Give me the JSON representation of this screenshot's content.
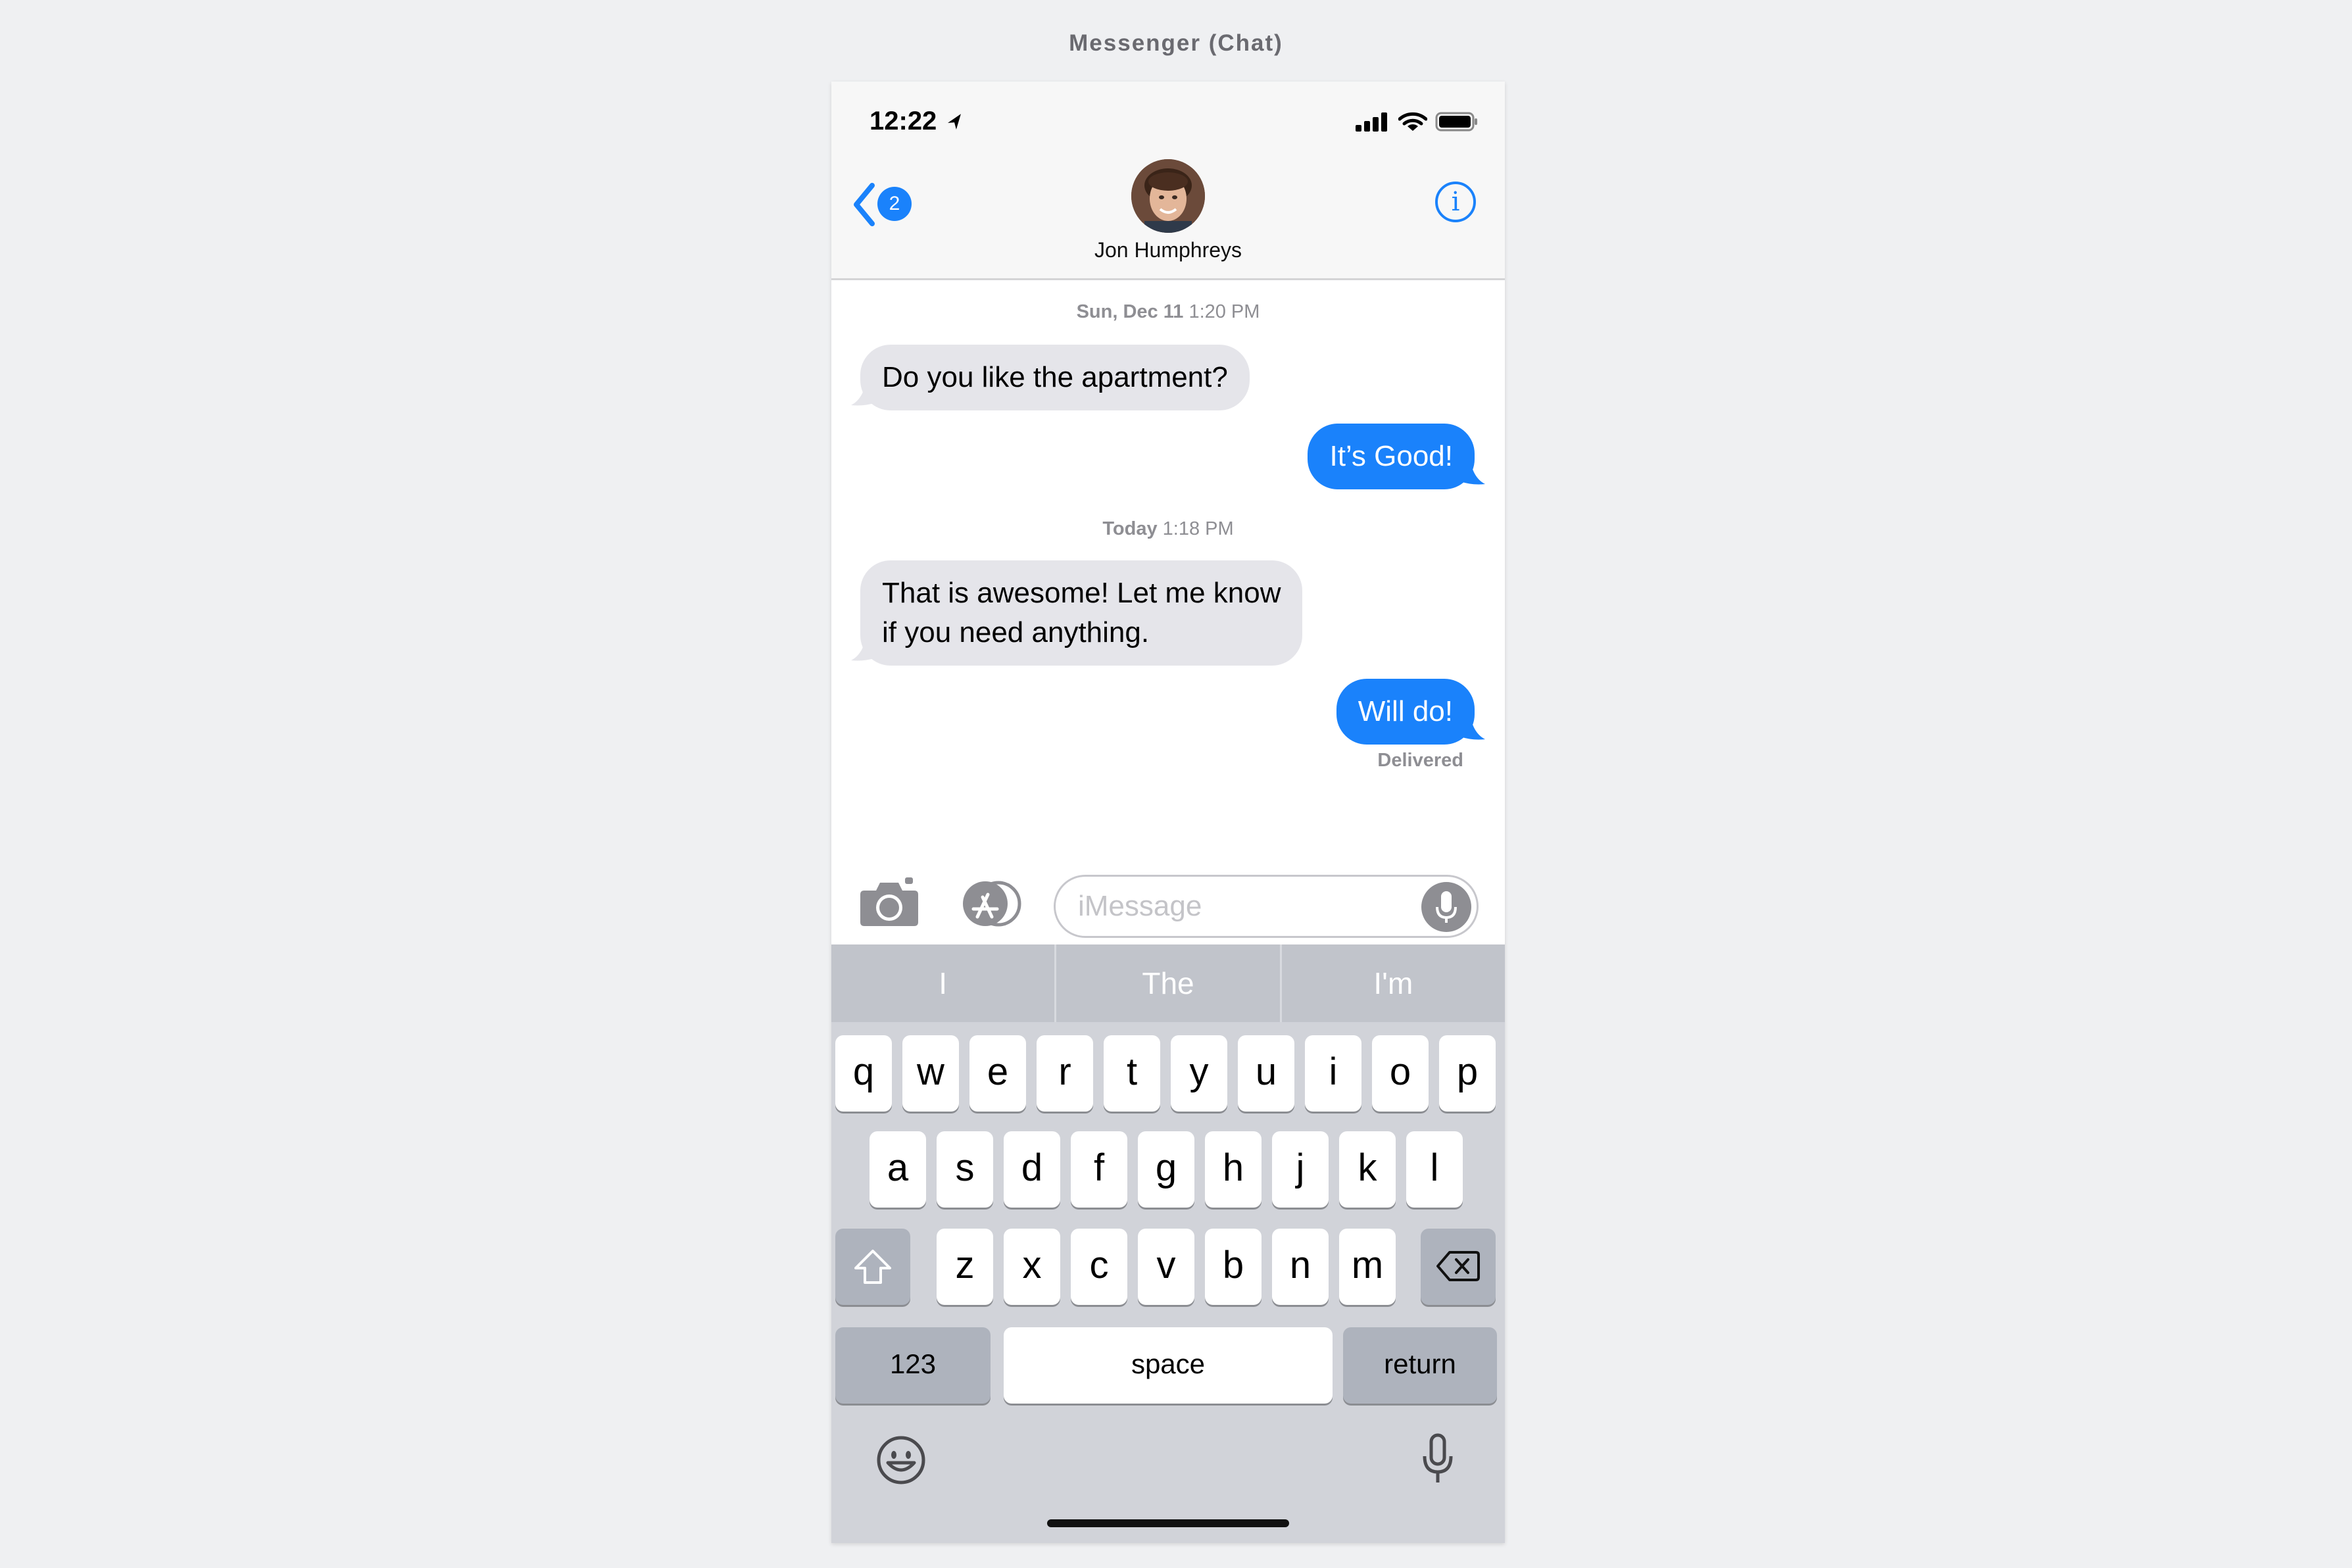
{
  "page": {
    "title": "Messenger (Chat)"
  },
  "status_bar": {
    "time": "12:22"
  },
  "header": {
    "back_badge": "2",
    "contact_name": "Jon Humphreys",
    "info_glyph": "i"
  },
  "chat": {
    "timestamps": [
      {
        "day": "Sun, Dec 11",
        "time": "1:20 PM"
      },
      {
        "day": "Today",
        "time": "1:18 PM"
      }
    ],
    "messages": [
      {
        "direction": "incoming",
        "lines": [
          "Do you like the apartment?"
        ]
      },
      {
        "direction": "outgoing",
        "lines": [
          "It’s Good!"
        ]
      },
      {
        "direction": "incoming",
        "lines": [
          "That is awesome! Let me know",
          "if you need anything."
        ]
      },
      {
        "direction": "outgoing",
        "lines": [
          "Will do!"
        ]
      }
    ],
    "delivery_status": "Delivered"
  },
  "input_bar": {
    "placeholder": "iMessage"
  },
  "keyboard": {
    "suggestions": [
      "I",
      "The",
      "I'm"
    ],
    "row1": [
      "q",
      "w",
      "e",
      "r",
      "t",
      "y",
      "u",
      "i",
      "o",
      "p"
    ],
    "row2": [
      "a",
      "s",
      "d",
      "f",
      "g",
      "h",
      "j",
      "k",
      "l"
    ],
    "row3": [
      "z",
      "x",
      "c",
      "v",
      "b",
      "n",
      "m"
    ],
    "numbers_label": "123",
    "space_label": "space",
    "return_label": "return"
  },
  "colors": {
    "accent": "#1a82fb",
    "incoming_bubble": "#e5e5ea",
    "keyboard_bg": "#d1d3d9"
  },
  "icons": [
    "location-arrow-icon",
    "signal-icon",
    "wifi-icon",
    "battery-icon",
    "chevron-left-icon",
    "info-icon",
    "camera-icon",
    "app-store-icon",
    "microphone-icon",
    "shift-icon",
    "backspace-icon",
    "emoji-icon",
    "dictation-mic-icon"
  ]
}
